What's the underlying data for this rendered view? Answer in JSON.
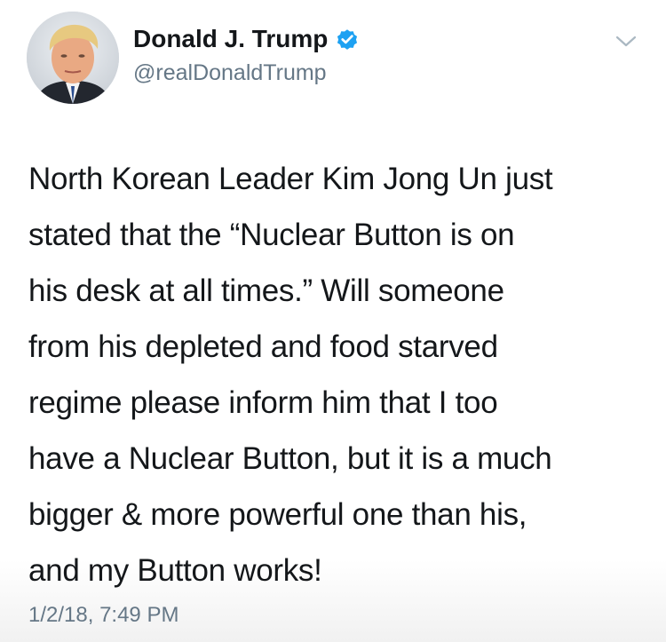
{
  "author": {
    "name": "Donald J. Trump",
    "handle": "@realDonaldTrump",
    "verified": true
  },
  "tweet": {
    "text": "North Korean Leader Kim Jong Un just\nstated that the “Nuclear Button is on\nhis desk at all times.” Will someone\nfrom his depleted and food starved\nregime please inform him that I too\nhave a Nuclear Button, but it is a much\nbigger & more powerful one than his,\nand my Button works!",
    "timestamp": "1/2/18, 7:49 PM"
  },
  "icons": {
    "verified": "verified-badge-icon",
    "menu": "chevron-down-icon"
  },
  "colors": {
    "verified_blue": "#1da1f2",
    "secondary_text": "#657786",
    "primary_text": "#14171a"
  }
}
